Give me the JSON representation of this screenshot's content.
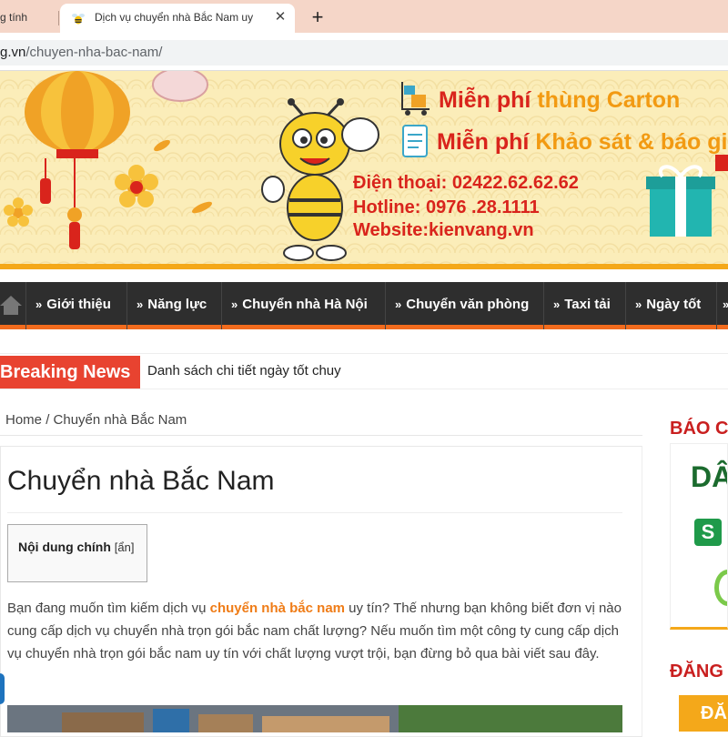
{
  "browser": {
    "prev_tab_title": "g tính",
    "active_tab_title": "Dịch vụ chuyển nhà Bắc Nam uy",
    "new_tab": "+",
    "close": "✕",
    "url_host": "g.vn",
    "url_path": "/chuyen-nha-bac-nam/"
  },
  "banner": {
    "promo1_prefix": "Miễn phí",
    "promo1_highlight": "thùng Carton",
    "promo2_prefix": "Miễn phí",
    "promo2_highlight": "Khảo sát & báo giá",
    "phone": "Điện thoại: 02422.62.62.62",
    "hotline": "Hotline: 0976 .28.1111",
    "website": "Website:kienvang.vn"
  },
  "nav": {
    "items": [
      {
        "label": "Giới thiệu"
      },
      {
        "label": "Năng lực"
      },
      {
        "label": "Chuyển nhà Hà Nội"
      },
      {
        "label": "Chuyển văn phòng"
      },
      {
        "label": "Taxi tải"
      },
      {
        "label": "Ngày tốt"
      }
    ],
    "arrow": "»"
  },
  "breaking": {
    "label": "Breaking News",
    "text": "Danh sách chi tiết ngày tốt chuy"
  },
  "breadcrumb": {
    "home": "Home",
    "sep": "/",
    "current": "Chuyển nhà Bắc Nam"
  },
  "article": {
    "title": "Chuyển nhà Bắc Nam",
    "toc_title": "Nội dung chính",
    "toc_toggle": "[ẩn]",
    "intro_before": "Bạn đang muốn tìm kiếm dịch vụ",
    "intro_keyword": "chuyển nhà bắc nam",
    "intro_after": "uy tín? Thế nhưng bạn không biết đơn vị nào cung cấp dịch vụ chuyển nhà trọn gói bắc nam chất lượng? Nếu muốn tìm một công ty cung cấp dịch vụ chuyển nhà trọn gói bắc nam uy tín với chất lượng vượt trội, bạn đừng bỏ qua bài viết sau đây."
  },
  "sidebar": {
    "heading1": "BÁO C",
    "logo1": "DÂ",
    "logo2": "S",
    "heading2": "ĐĂNG",
    "button": "ĐĂ"
  },
  "colors": {
    "accent": "#f26b1d",
    "brand_red": "#d9241c",
    "breaking_red": "#e84330",
    "keyword_orange": "#ef7c17",
    "banner_bg": "#fbedb9"
  }
}
